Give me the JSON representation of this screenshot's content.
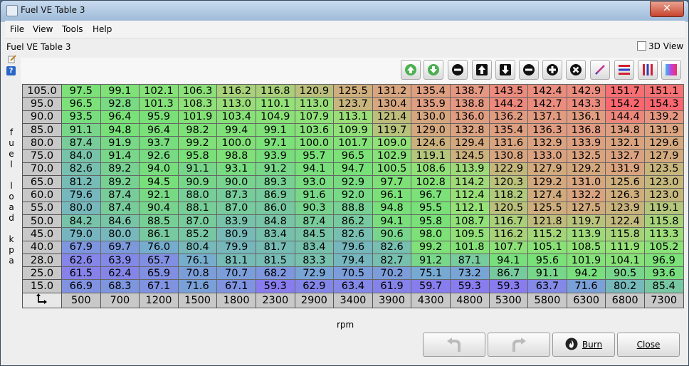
{
  "window": {
    "title": "Fuel VE Table 3"
  },
  "menu": [
    "File",
    "View",
    "Tools",
    "Help"
  ],
  "panel_title": "Fuel VE Table 3",
  "view3d_label": "3D View",
  "y_axis_label": "fuel load kpa",
  "x_axis_label": "rpm",
  "toolbar_icons": [
    "arrow-up-green-icon",
    "arrow-down-green-icon",
    "minus-icon",
    "arrow-up-icon",
    "arrow-down-icon",
    "minus-icon",
    "plus-icon",
    "multiply-icon",
    "interpolate-pen-icon",
    "horizontal-lines-icon",
    "vertical-lines-icon",
    "color-gradient-icon"
  ],
  "table": {
    "corner_icon": "axis-swap-icon",
    "rpm": [
      "500",
      "700",
      "1200",
      "1500",
      "1800",
      "2300",
      "2900",
      "3400",
      "3900",
      "4300",
      "4800",
      "5300",
      "5800",
      "6300",
      "6800",
      "7300"
    ],
    "rows": [
      {
        "load": "105.0",
        "values": [
          "97.5",
          "99.1",
          "102.1",
          "106.3",
          "116.2",
          "116.8",
          "120.9",
          "125.5",
          "131.2",
          "135.4",
          "138.7",
          "143.5",
          "142.4",
          "142.9",
          "151.7",
          "151.1"
        ]
      },
      {
        "load": "95.0",
        "values": [
          "96.5",
          "92.8",
          "101.3",
          "108.3",
          "113.0",
          "110.1",
          "113.0",
          "123.7",
          "130.4",
          "135.9",
          "138.8",
          "144.2",
          "142.7",
          "143.3",
          "154.2",
          "154.3"
        ]
      },
      {
        "load": "90.0",
        "values": [
          "93.5",
          "96.4",
          "95.9",
          "101.9",
          "103.4",
          "104.9",
          "107.9",
          "113.1",
          "121.4",
          "130.0",
          "136.0",
          "136.2",
          "137.1",
          "136.1",
          "144.4",
          "139.2"
        ]
      },
      {
        "load": "85.0",
        "values": [
          "91.1",
          "94.8",
          "96.4",
          "98.2",
          "99.4",
          "99.1",
          "103.6",
          "109.9",
          "119.7",
          "129.0",
          "132.8",
          "135.4",
          "136.3",
          "136.8",
          "134.8",
          "131.9"
        ]
      },
      {
        "load": "80.0",
        "values": [
          "87.4",
          "91.9",
          "93.7",
          "99.2",
          "100.0",
          "97.1",
          "100.0",
          "101.7",
          "109.0",
          "124.6",
          "129.4",
          "131.6",
          "132.9",
          "133.9",
          "132.1",
          "129.6"
        ]
      },
      {
        "load": "75.0",
        "values": [
          "84.0",
          "91.4",
          "92.6",
          "95.8",
          "98.8",
          "93.9",
          "95.7",
          "96.5",
          "102.9",
          "119.1",
          "124.5",
          "130.8",
          "133.0",
          "132.5",
          "132.7",
          "127.9"
        ]
      },
      {
        "load": "70.0",
        "values": [
          "82.6",
          "89.2",
          "94.0",
          "91.1",
          "93.1",
          "91.2",
          "94.1",
          "94.7",
          "100.5",
          "108.6",
          "113.9",
          "122.9",
          "127.9",
          "129.2",
          "131.9",
          "123.5"
        ]
      },
      {
        "load": "65.0",
        "values": [
          "81.2",
          "89.2",
          "94.5",
          "90.9",
          "90.0",
          "89.3",
          "93.0",
          "92.9",
          "97.7",
          "102.8",
          "114.2",
          "120.3",
          "129.2",
          "131.0",
          "125.6",
          "123.0"
        ]
      },
      {
        "load": "60.0",
        "values": [
          "79.6",
          "87.4",
          "92.1",
          "88.0",
          "87.3",
          "86.9",
          "91.6",
          "92.0",
          "96.1",
          "96.7",
          "112.4",
          "118.2",
          "127.4",
          "132.2",
          "126.3",
          "123.0"
        ]
      },
      {
        "load": "55.0",
        "values": [
          "80.0",
          "87.4",
          "90.4",
          "88.1",
          "87.0",
          "86.0",
          "90.3",
          "88.8",
          "94.8",
          "95.5",
          "112.1",
          "120.5",
          "125.5",
          "127.5",
          "123.9",
          "119.1"
        ]
      },
      {
        "load": "50.0",
        "values": [
          "84.2",
          "84.6",
          "88.5",
          "87.0",
          "83.9",
          "84.8",
          "87.4",
          "86.2",
          "94.1",
          "95.8",
          "108.7",
          "116.7",
          "121.8",
          "119.7",
          "122.4",
          "115.8"
        ]
      },
      {
        "load": "45.0",
        "values": [
          "79.0",
          "80.0",
          "86.1",
          "85.2",
          "80.9",
          "83.4",
          "84.5",
          "82.6",
          "90.6",
          "98.0",
          "109.5",
          "116.2",
          "115.2",
          "113.9",
          "115.8",
          "113.3"
        ]
      },
      {
        "load": "40.0",
        "values": [
          "67.9",
          "69.7",
          "76.0",
          "80.4",
          "79.9",
          "81.7",
          "83.4",
          "79.6",
          "82.6",
          "99.2",
          "101.8",
          "107.7",
          "105.1",
          "108.5",
          "111.9",
          "105.2"
        ]
      },
      {
        "load": "28.0",
        "values": [
          "62.6",
          "63.9",
          "65.7",
          "76.1",
          "81.1",
          "81.5",
          "83.3",
          "79.4",
          "82.7",
          "91.2",
          "87.1",
          "94.1",
          "95.6",
          "101.9",
          "104.1",
          "96.9"
        ]
      },
      {
        "load": "25.0",
        "values": [
          "61.5",
          "62.4",
          "65.9",
          "70.8",
          "70.7",
          "68.2",
          "72.9",
          "70.5",
          "70.2",
          "75.1",
          "73.2",
          "86.7",
          "91.1",
          "94.2",
          "90.5",
          "93.6"
        ]
      },
      {
        "load": "15.0",
        "values": [
          "66.9",
          "68.3",
          "67.1",
          "71.6",
          "67.1",
          "59.3",
          "62.9",
          "63.4",
          "61.9",
          "59.7",
          "59.3",
          "59.3",
          "63.7",
          "71.6",
          "80.2",
          "85.4"
        ]
      }
    ]
  },
  "buttons": {
    "undo_icon": "undo-icon",
    "redo_icon": "redo-icon",
    "burn": "Burn",
    "burn_icon": "flame-icon",
    "close": "Close"
  }
}
